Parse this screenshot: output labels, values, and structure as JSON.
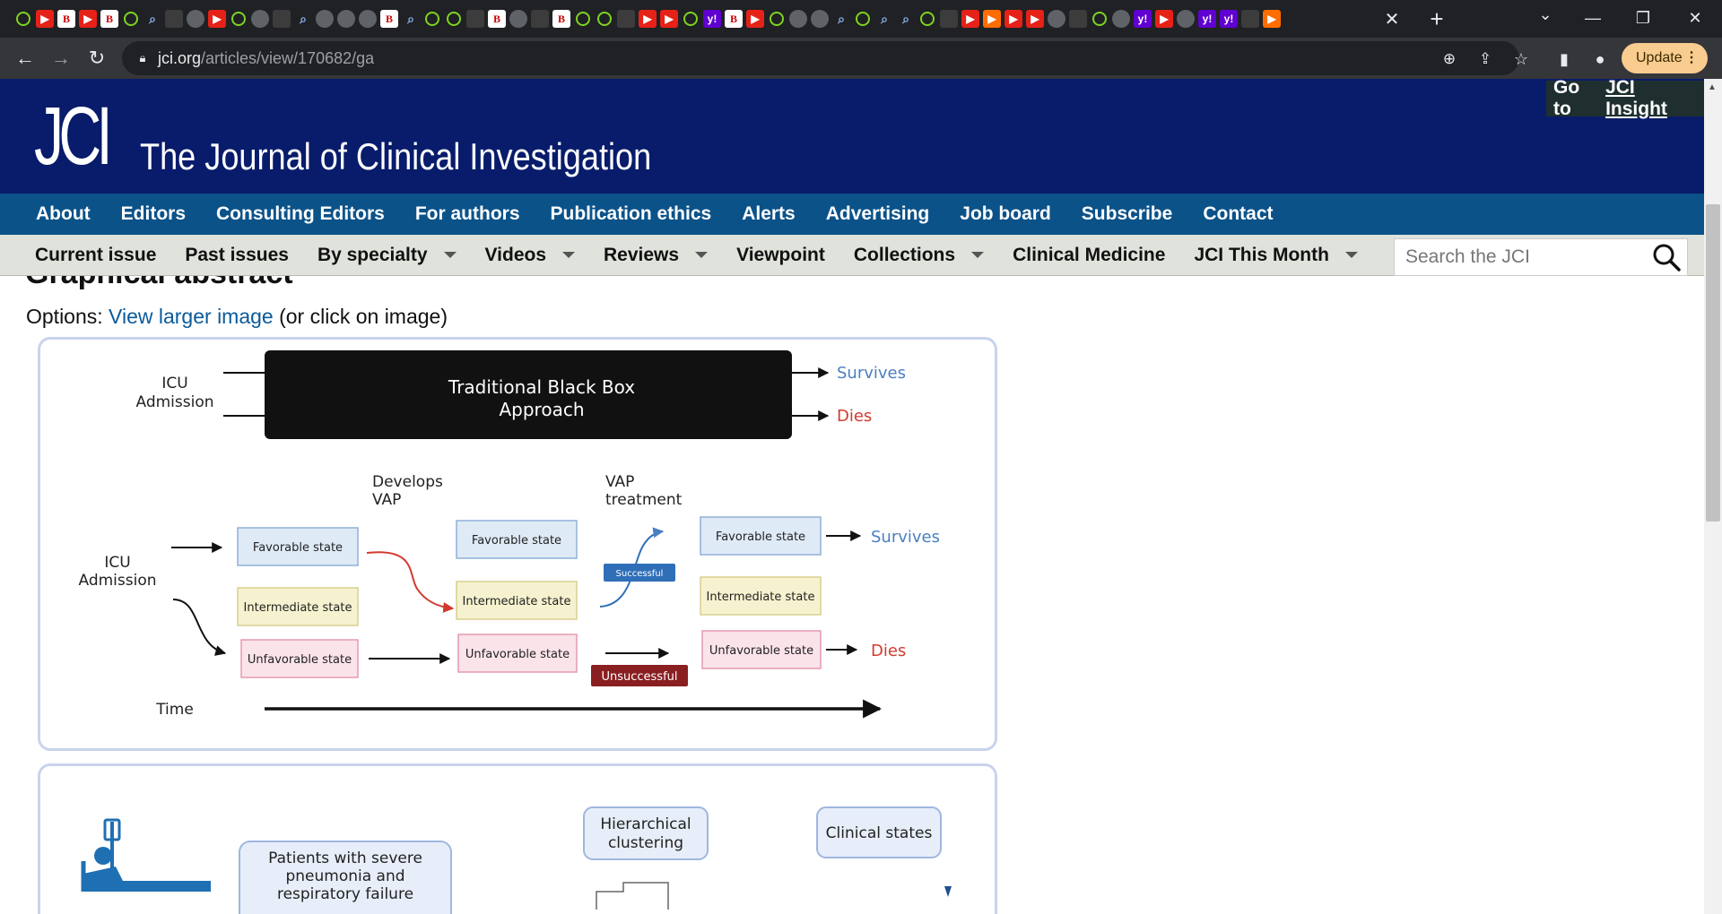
{
  "browser": {
    "url_host": "jci.org",
    "url_path": "/articles/view/170682/ga",
    "update_label": "Update",
    "tab_icons": [
      "play",
      "red",
      "bi",
      "red",
      "bi",
      "play",
      "lens",
      "dark",
      "globe",
      "red",
      "play",
      "globe",
      "dark",
      "lens",
      "globe",
      "globe",
      "globe",
      "bi",
      "lens",
      "play",
      "play",
      "dark",
      "bi",
      "globe",
      "dark",
      "bi",
      "play",
      "play",
      "dark",
      "red",
      "red",
      "play",
      "yahoo",
      "bi",
      "red",
      "play",
      "globe",
      "globe",
      "lens",
      "play",
      "lens",
      "lens",
      "play",
      "dark",
      "red",
      "orange",
      "red",
      "red",
      "globe",
      "dark",
      "play",
      "globe",
      "yahoo",
      "red",
      "globe",
      "yahoo",
      "yahoo",
      "dark",
      "orange"
    ]
  },
  "header": {
    "logo": "JCI",
    "journal_title": "The Journal of Clinical Investigation",
    "insight_prefix": "Go to",
    "insight_link": "JCI Insight"
  },
  "nav_primary": [
    "About",
    "Editors",
    "Consulting Editors",
    "For authors",
    "Publication ethics",
    "Alerts",
    "Advertising",
    "Job board",
    "Subscribe",
    "Contact"
  ],
  "nav_secondary": [
    {
      "label": "Current issue",
      "dropdown": false
    },
    {
      "label": "Past issues",
      "dropdown": false
    },
    {
      "label": "By specialty",
      "dropdown": true
    },
    {
      "label": "Videos",
      "dropdown": true
    },
    {
      "label": "Reviews",
      "dropdown": true
    },
    {
      "label": "Viewpoint",
      "dropdown": false
    },
    {
      "label": "Collections",
      "dropdown": true
    },
    {
      "label": "Clinical Medicine",
      "dropdown": false
    },
    {
      "label": "JCI This Month",
      "dropdown": true
    }
  ],
  "search": {
    "placeholder": "Search the JCI"
  },
  "article": {
    "section_heading": "Graphical abstract",
    "options_prefix": "Options:",
    "options_link": "View larger image",
    "options_suffix": "(or click on image)"
  },
  "figure1": {
    "top_icu": [
      "ICU",
      "Admission"
    ],
    "black_box": [
      "Traditional Black Box",
      "Approach"
    ],
    "top_survives": "Survives",
    "top_dies": "Dies",
    "develops_vap": [
      "Develops",
      "VAP"
    ],
    "vap_treatment": [
      "VAP",
      "treatment"
    ],
    "icu": [
      "ICU",
      "Admission"
    ],
    "favorable": "Favorable state",
    "intermediate": "Intermediate state",
    "unfavorable": "Unfavorable state",
    "successful": "Successful",
    "unsuccessful": "Unsuccessful",
    "survives": "Survives",
    "dies": "Dies",
    "time": "Time",
    "colors": {
      "favorable": "#dfeaf7",
      "intermediate": "#f6f2cf",
      "unfavorable": "#fbe3ea",
      "survives": "#4a7fc1",
      "dies": "#d23a2f",
      "successful": "#2f6fb8",
      "unsuccessful": "#8a1f22"
    }
  },
  "figure2": {
    "patients": [
      "Patients with severe",
      "pneumonia and",
      "respiratory failure"
    ],
    "clustering": [
      "Hierarchical",
      "clustering"
    ],
    "clinical_states": "Clinical states"
  }
}
